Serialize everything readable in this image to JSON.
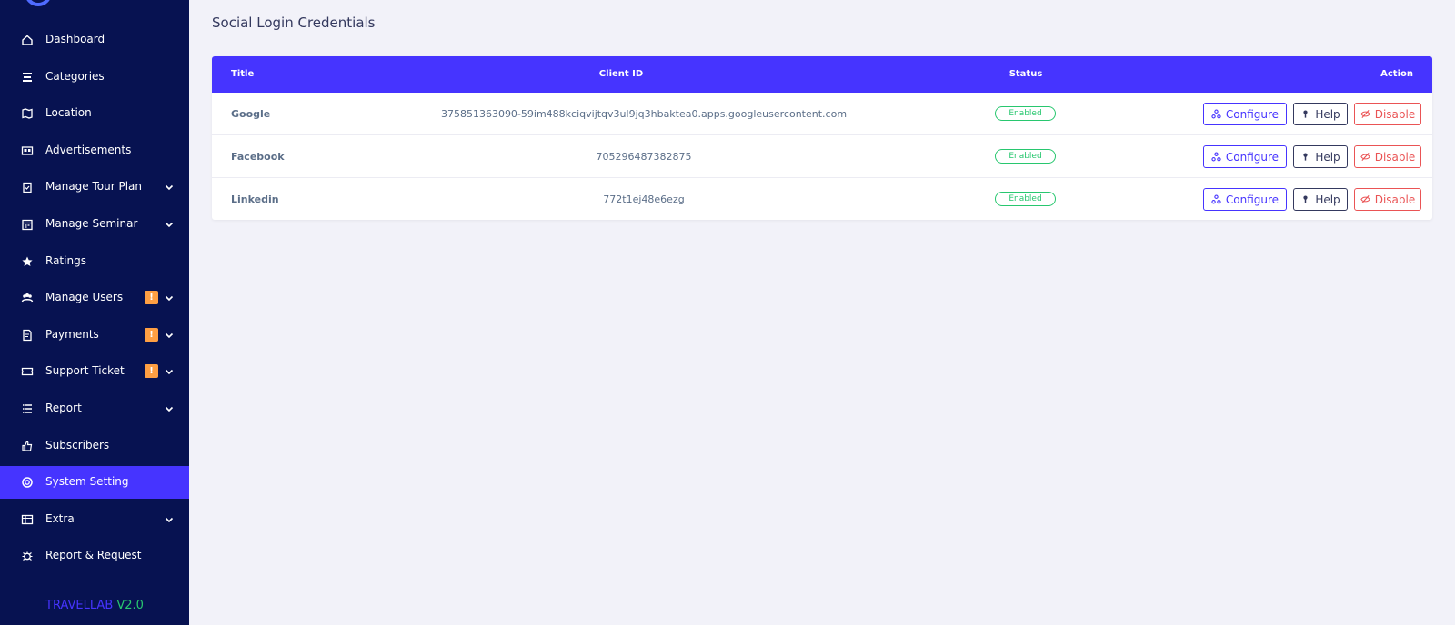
{
  "sidebar": {
    "items": [
      {
        "label": "Dashboard",
        "icon": "home-icon",
        "badge": null,
        "chevron": false,
        "active": false
      },
      {
        "label": "Categories",
        "icon": "layers-icon",
        "badge": null,
        "chevron": false,
        "active": false
      },
      {
        "label": "Location",
        "icon": "map-icon",
        "badge": null,
        "chevron": false,
        "active": false
      },
      {
        "label": "Advertisements",
        "icon": "ad-icon",
        "badge": null,
        "chevron": false,
        "active": false
      },
      {
        "label": "Manage Tour Plan",
        "icon": "clipboard-icon",
        "badge": null,
        "chevron": true,
        "active": false
      },
      {
        "label": "Manage Seminar",
        "icon": "calendar-icon",
        "badge": null,
        "chevron": true,
        "active": false
      },
      {
        "label": "Ratings",
        "icon": "star-icon",
        "badge": null,
        "chevron": false,
        "active": false
      },
      {
        "label": "Manage Users",
        "icon": "users-icon",
        "badge": "!",
        "chevron": true,
        "active": false
      },
      {
        "label": "Payments",
        "icon": "invoice-icon",
        "badge": "!",
        "chevron": true,
        "active": false
      },
      {
        "label": "Support Ticket",
        "icon": "ticket-icon",
        "badge": "!",
        "chevron": true,
        "active": false
      },
      {
        "label": "Report",
        "icon": "list-icon",
        "badge": null,
        "chevron": true,
        "active": false
      },
      {
        "label": "Subscribers",
        "icon": "thumbs-up-icon",
        "badge": null,
        "chevron": false,
        "active": false
      },
      {
        "label": "System Setting",
        "icon": "lifebuoy-icon",
        "badge": null,
        "chevron": false,
        "active": true
      },
      {
        "label": "Extra",
        "icon": "table-icon",
        "badge": null,
        "chevron": true,
        "active": false
      },
      {
        "label": "Report & Request",
        "icon": "bug-icon",
        "badge": null,
        "chevron": false,
        "active": false
      }
    ],
    "version_brand": "TRAVELLAB",
    "version_number": "V2.0"
  },
  "page": {
    "title": "Social Login Credentials"
  },
  "table": {
    "headers": {
      "title": "Title",
      "client_id": "Client ID",
      "status": "Status",
      "action": "Action"
    },
    "rows": [
      {
        "title": "Google",
        "client_id": "375851363090-59im488kciqvijtqv3ul9jq3hbaktea0.apps.googleusercontent.com",
        "status": "Enabled"
      },
      {
        "title": "Facebook",
        "client_id": "705296487382875",
        "status": "Enabled"
      },
      {
        "title": "Linkedin",
        "client_id": "772t1ej48e6ezg",
        "status": "Enabled"
      }
    ],
    "actions": {
      "configure": "Configure",
      "help": "Help",
      "disable": "Disable"
    }
  },
  "colors": {
    "sidebar_bg": "#071251",
    "accent": "#4634ff",
    "success": "#28c76f",
    "danger": "#ea5455",
    "warning": "#ff9f43"
  }
}
